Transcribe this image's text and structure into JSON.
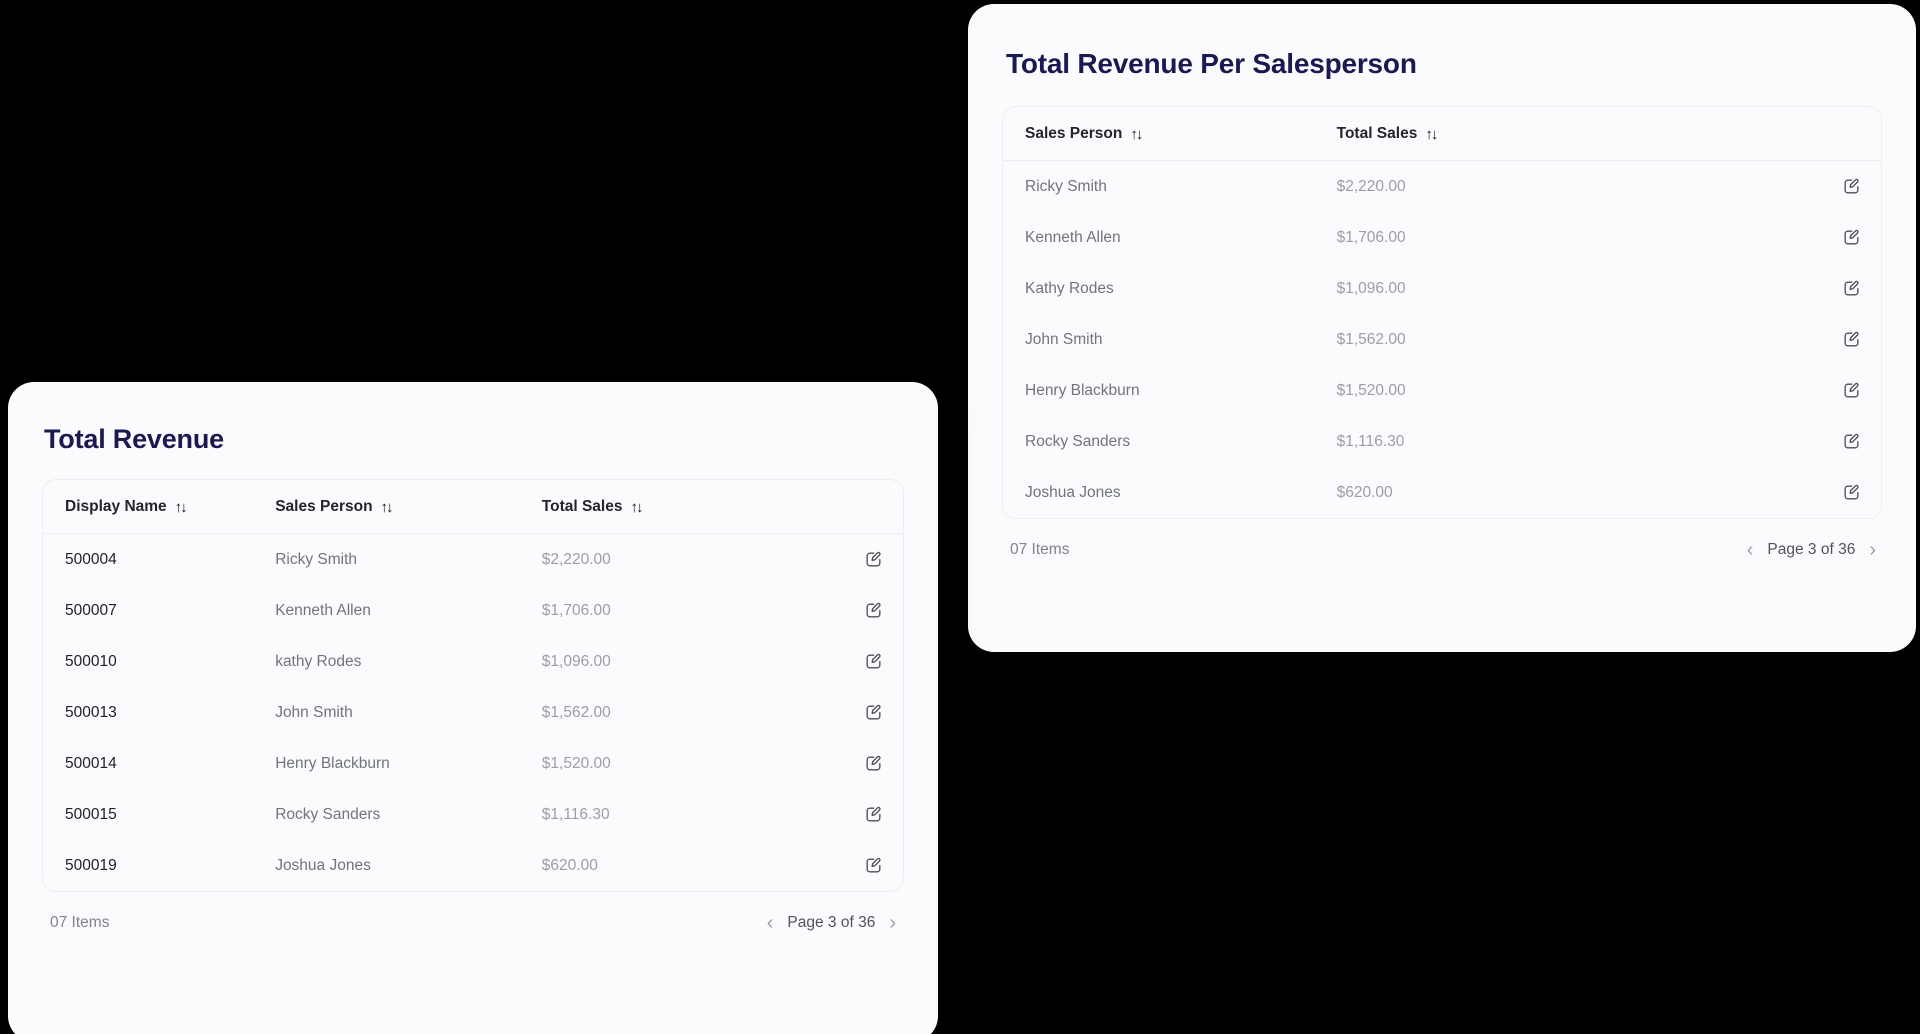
{
  "theme": {
    "page_background": "#000000",
    "card_background": "#fbfbfd",
    "title_color": "#1a1a52",
    "header_text_color": "#22252c",
    "body_text_color": "#70747e",
    "amount_text_color": "#9a9ea7",
    "border_color": "#eceef2"
  },
  "icons": {
    "sort": "↑↓",
    "prev": "‹",
    "next": "›",
    "edit_name": "edit-pencil-square-icon"
  },
  "right_card": {
    "title": "Total Revenue Per Salesperson",
    "columns": [
      {
        "label": "Sales Person",
        "sortable": true
      },
      {
        "label": "Total Sales",
        "sortable": true
      },
      {
        "label": "",
        "sortable": false
      }
    ],
    "rows": [
      {
        "sales_person": "Ricky Smith",
        "total_sales": "$2,220.00",
        "action": "edit"
      },
      {
        "sales_person": "Kenneth Allen",
        "total_sales": "$1,706.00",
        "action": "edit"
      },
      {
        "sales_person": "Kathy Rodes",
        "total_sales": "$1,096.00",
        "action": "edit"
      },
      {
        "sales_person": "John Smith",
        "total_sales": "$1,562.00",
        "action": "edit"
      },
      {
        "sales_person": "Henry Blackburn",
        "total_sales": "$1,520.00",
        "action": "edit"
      },
      {
        "sales_person": "Rocky Sanders",
        "total_sales": "$1,116.30",
        "action": "edit"
      },
      {
        "sales_person": "Joshua Jones",
        "total_sales": "$620.00",
        "action": "edit"
      }
    ],
    "footer": {
      "items_count": "07 Items",
      "page_label": "Page 3 of 36",
      "current_page": 3,
      "total_pages": 36
    }
  },
  "left_card": {
    "title": "Total Revenue",
    "columns": [
      {
        "label": "Display Name",
        "sortable": true
      },
      {
        "label": "Sales Person",
        "sortable": true
      },
      {
        "label": "Total Sales",
        "sortable": true
      },
      {
        "label": "",
        "sortable": false
      }
    ],
    "rows": [
      {
        "display_name": "500004",
        "sales_person": "Ricky Smith",
        "total_sales": "$2,220.00",
        "action": "edit"
      },
      {
        "display_name": "500007",
        "sales_person": "Kenneth Allen",
        "total_sales": "$1,706.00",
        "action": "edit"
      },
      {
        "display_name": "500010",
        "sales_person": "kathy Rodes",
        "total_sales": "$1,096.00",
        "action": "edit"
      },
      {
        "display_name": "500013",
        "sales_person": "John Smith",
        "total_sales": "$1,562.00",
        "action": "edit"
      },
      {
        "display_name": "500014",
        "sales_person": "Henry Blackburn",
        "total_sales": "$1,520.00",
        "action": "edit"
      },
      {
        "display_name": "500015",
        "sales_person": "Rocky Sanders",
        "total_sales": "$1,116.30",
        "action": "edit"
      },
      {
        "display_name": "500019",
        "sales_person": "Joshua Jones",
        "total_sales": "$620.00",
        "action": "edit"
      }
    ],
    "footer": {
      "items_count": "07 Items",
      "page_label": "Page 3 of 36",
      "current_page": 3,
      "total_pages": 36
    }
  }
}
